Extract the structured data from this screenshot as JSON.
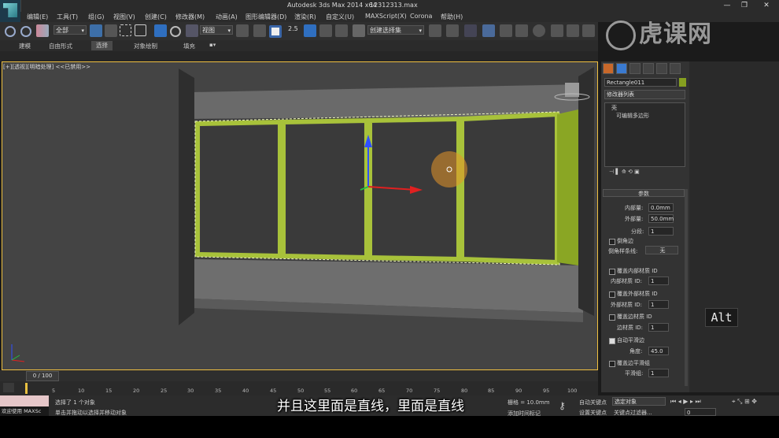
{
  "window": {
    "title": "Autodesk 3ds Max  2014 x64",
    "file": "12312313.max",
    "minimize": "—",
    "restore": "❐",
    "close": "✕"
  },
  "menu": [
    "编辑(E)",
    "工具(T)",
    "组(G)",
    "视图(V)",
    "创建(C)",
    "修改器(M)",
    "动画(A)",
    "图形编辑器(D)",
    "渲染(R)",
    "自定义(U)",
    "MAXScript(X)",
    "Corona",
    "帮助(H)"
  ],
  "toolbar": {
    "filter_select": "全部",
    "coord_select": "视图",
    "snap_label": "2.5",
    "named_selection": "创建选择集"
  },
  "ribbon": {
    "tabs": [
      "建模",
      "自由形式",
      "选择",
      "对象绘制",
      "填充"
    ],
    "active_tab": "选择"
  },
  "viewport": {
    "label": "[+][透视][明暗处理]  <<已禁用>>"
  },
  "command_panel": {
    "object_name": "Rectangle011",
    "object_color": "#86a020",
    "modifier_list": "修改器列表",
    "stack": [
      "壳",
      "可编辑多边形"
    ],
    "rollout_title": "参数",
    "inner_amount_label": "内部量:",
    "inner_amount": "0.0mm",
    "outer_amount_label": "外部量:",
    "outer_amount": "50.0mm",
    "segments_label": "分段:",
    "segments": "1",
    "bevel_edges": "倒角边",
    "bevel_spline_label": "倒角样条线:",
    "bevel_spline_value": "无",
    "override_inner_mat": "覆盖内部材质 ID",
    "inner_mat_label": "内部材质 ID:",
    "inner_mat_value": "1",
    "override_outer_mat": "覆盖外部材质 ID",
    "outer_mat_label": "外部材质 ID:",
    "outer_mat_value": "1",
    "override_edge_mat": "覆盖边材质 ID",
    "edge_mat_label": "边材质 ID:",
    "edge_mat_value": "1",
    "auto_smooth": "自动平滑边",
    "angle_label": "角度:",
    "angle_value": "45.0",
    "override_smooth": "覆盖边平滑组",
    "smooth_group_label": "平滑组:",
    "smooth_group_value": "1"
  },
  "timeline": {
    "frame": "0 / 100",
    "ticks": [
      "0",
      "5",
      "10",
      "15",
      "20",
      "25",
      "30",
      "35",
      "40",
      "45",
      "50",
      "55",
      "60",
      "65",
      "70",
      "75",
      "80",
      "85",
      "90",
      "95",
      "100"
    ]
  },
  "status": {
    "welcome": "欢迎使用 MAXSc",
    "selected": "选择了 1 个对象",
    "prompt": "单击并拖动以选择并移动对象",
    "grid": "栅格 = 10.0mm",
    "auto_key": "自动关键点",
    "selected_obj": "选定对象",
    "set_key": "设置关键点",
    "key_filter": "关键点过滤器...",
    "add_time_tag": "添加时间标记",
    "frame_value": "0"
  },
  "subtitle": "并且这里面是直线，里面是直线",
  "overlay": {
    "alt_key": "Alt"
  },
  "watermark": "虎课网"
}
